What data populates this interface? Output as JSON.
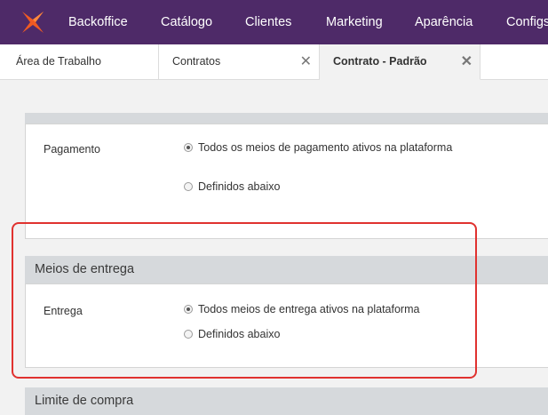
{
  "topnav": {
    "logo_icon": "star-logo-icon",
    "items": [
      "Backoffice",
      "Catálogo",
      "Clientes",
      "Marketing",
      "Aparência",
      "Configs"
    ]
  },
  "tabs": [
    {
      "label": "Área de Trabalho",
      "closable": false
    },
    {
      "label": "Contratos",
      "closable": true
    },
    {
      "label": "Contrato - Padrão",
      "closable": true,
      "active": true
    }
  ],
  "close_glyph": "✕",
  "sections": {
    "pagamento": {
      "field_label": "Pagamento",
      "options": [
        "Todos os meios de pagamento ativos na plataforma",
        "Definidos abaixo"
      ],
      "selected": 0
    },
    "entrega": {
      "title": "Meios de entrega",
      "field_label": "Entrega",
      "options": [
        "Todos meios de entrega ativos na plataforma",
        "Definidos abaixo"
      ],
      "selected": 0
    },
    "limite": {
      "title": "Limite de compra"
    }
  },
  "colors": {
    "nav_bg": "#4e2a68",
    "highlight": "#e0322f"
  }
}
